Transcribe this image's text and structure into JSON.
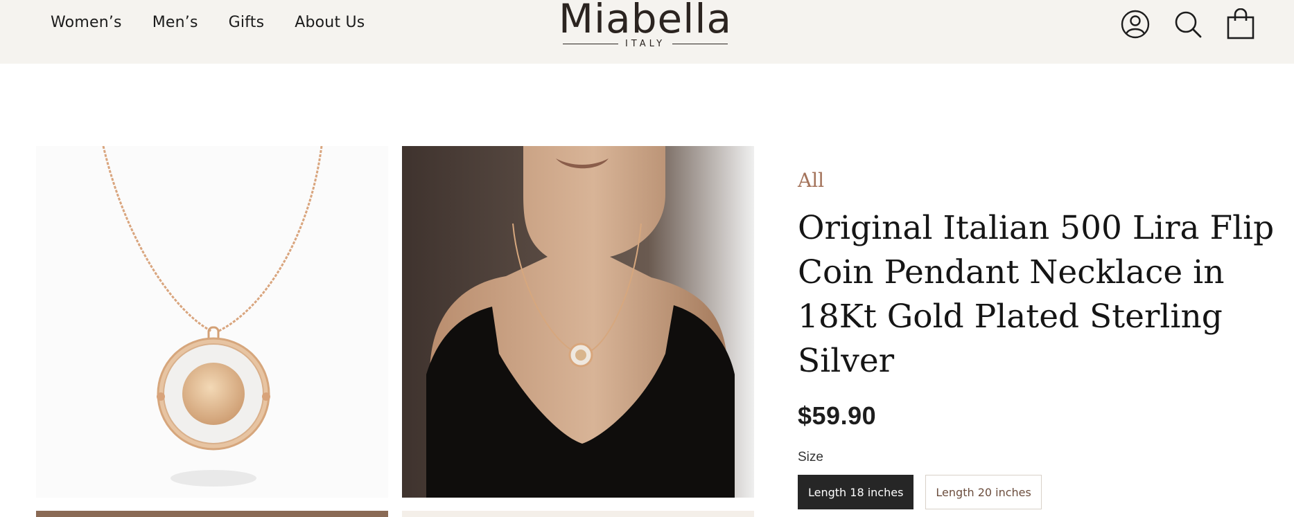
{
  "header": {
    "nav": [
      {
        "label": "Women’s"
      },
      {
        "label": "Men’s"
      },
      {
        "label": "Gifts"
      },
      {
        "label": "About Us"
      }
    ],
    "logo": {
      "wordmark": "Miabella",
      "subtitle": "ITALY"
    },
    "icons": [
      "account-icon",
      "search-icon",
      "cart-icon"
    ]
  },
  "product": {
    "breadcrumb": "All",
    "title": "Original Italian 500 Lira Flip Coin Pendant Necklace in 18Kt Gold Plated Sterling Silver",
    "price": "$59.90",
    "size_label": "Size",
    "sizes": [
      {
        "label": "Length 18 inches",
        "selected": true
      },
      {
        "label": "Length 20 inches",
        "selected": false
      }
    ]
  },
  "colors": {
    "header_bg": "#f5f3ef",
    "accent": "#a4735b",
    "selected_bg": "#262626"
  }
}
